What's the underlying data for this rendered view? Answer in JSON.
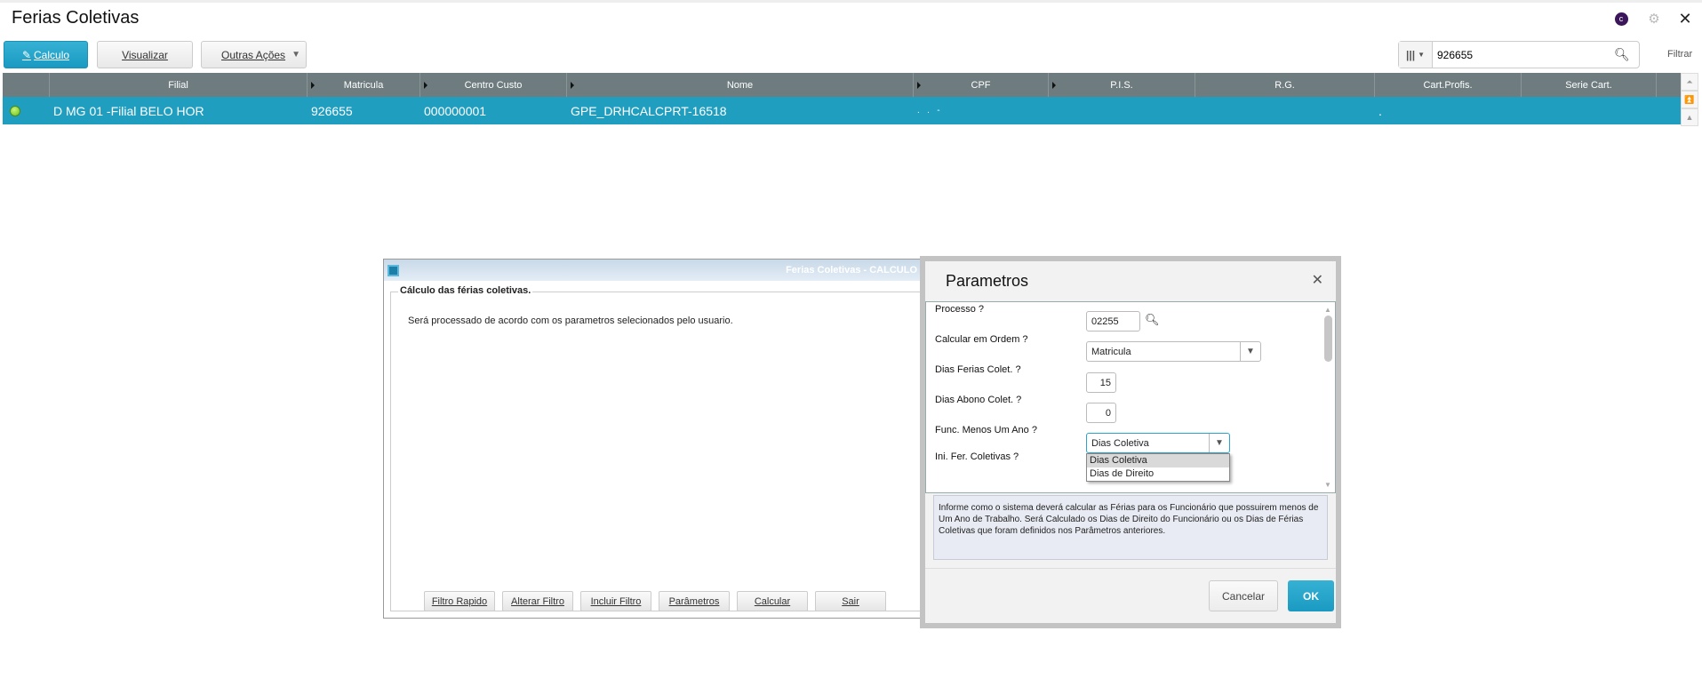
{
  "app": {
    "title": "Ferias Coletivas",
    "icons": [
      "user-avatar-icon",
      "gear-icon",
      "close-icon"
    ]
  },
  "toolbar": {
    "calculo": "Calculo",
    "visualizar": "Visualizar",
    "outras": "Outras Ações",
    "search_value": "926655",
    "filtrar": "Filtrar"
  },
  "grid": {
    "columns": [
      "Filial",
      "Matricula",
      "Centro Custo",
      "Nome",
      "CPF",
      "P.I.S.",
      "R.G.",
      "Cart.Profis.",
      "Serie Cart."
    ],
    "rows": [
      {
        "status_color": "#7ed321",
        "filial": "D MG 01 -Filial BELO HOR",
        "matricula": "926655",
        "centro_custo": "000000001",
        "nome": "GPE_DRHCALCPRT-16518",
        "cpf": ".   .   -",
        "pis": "",
        "rg": "",
        "cart": ".",
        "serie": ""
      }
    ]
  },
  "calc_window": {
    "title": "Ferias Coletivas - CALCULO",
    "group": "Cálculo das férias coletivas.",
    "message": "Será processado de acordo com os parametros selecionados pelo usuario.",
    "buttons": [
      "Filtro Rapido",
      "Alterar Filtro",
      "Incluir Filtro",
      "Parâmetros",
      "Calcular",
      "Sair"
    ]
  },
  "params": {
    "title": "Parametros",
    "fields": [
      {
        "label": "Processo ?",
        "value": "02255"
      },
      {
        "label": "Calcular em Ordem ?",
        "value": "Matricula"
      },
      {
        "label": "Dias Ferias Colet. ?",
        "value": "15"
      },
      {
        "label": "Dias Abono Colet. ?",
        "value": "0"
      },
      {
        "label": "Func. Menos Um Ano ?",
        "value": "Dias Coletiva"
      },
      {
        "label": "Ini. Fer. Coletivas ?",
        "value": ""
      }
    ],
    "dropdown_options": [
      "Dias Coletiva",
      "Dias de Direito"
    ],
    "help": "Informe como o sistema deverá calcular as Férias  para os Funcionário que possuirem menos de Um Ano de Trabalho. Será Calculado os Dias de Direito do Funcionário ou os Dias de Férias Coletivas que foram definidos nos Parâmetros anteriores.",
    "cancel": "Cancelar",
    "ok": "OK"
  },
  "colors": {
    "accent": "#1f9ec0",
    "header": "#6f7c7f"
  }
}
